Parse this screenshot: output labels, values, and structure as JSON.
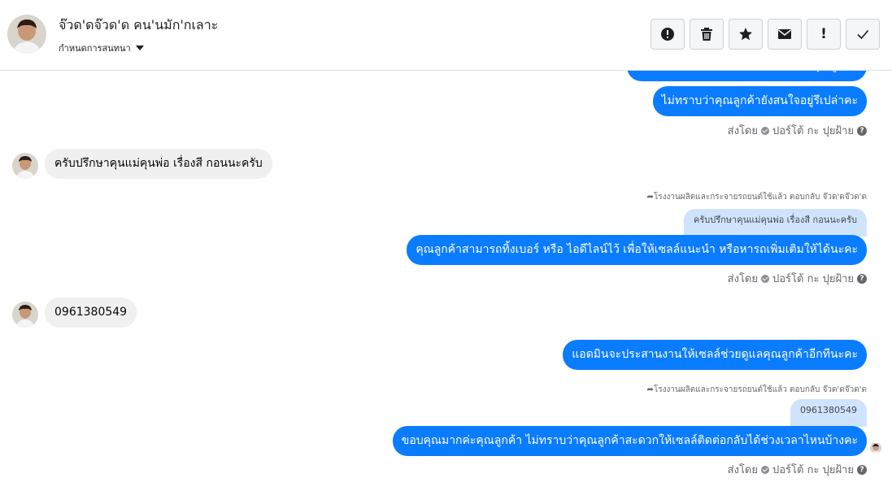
{
  "header": {
    "title": "จ๊วด'ดจ๊วด'ด คน'นมัก'กเลาะ",
    "subtitle": "กำหนดการสนทนา",
    "toolbar": {
      "alert_icon": "alert-circle-icon",
      "delete_icon": "trash-icon",
      "star_icon": "star-icon",
      "mail_icon": "envelope-icon",
      "important_icon": "exclamation-icon",
      "done_icon": "check-icon"
    }
  },
  "messages": {
    "m1_partial": "ทำที่นี่มีรายได้ไม่ได้ค่ะ แต่ได้รับเรื่องคุณลูกค้า",
    "m2": "ไม่ทราบว่าคุณลูกค้ายังสนใจอยู่รึเปล่าคะ",
    "sent_by_label": "ส่งโดย",
    "sent_by_name": "ปอร์โต้ กะ ปุยฝ้าย",
    "help": "?",
    "in1": "ครับปรึกษาคุนแม่คุนพ่อ เรื่องสี กอนนะครับ",
    "reply_meta_1": "โรงงานผลิตและกระจายรถยนต์ใช้แล้ว ตอบกลับ จ๊วด'ดจ๊วด'ด",
    "quote_1": "ครับปรึกษาคุนแม่คุนพ่อ เรื่องสี กอนนะครับ",
    "m3": "คุณลูกค้าสามารถทิ้งเบอร์ หรือ ไอดีไลน์ไว้ เพื่อให้เซลล์แนะนำ หรือหารถเพิ่มเติมให้ได้นะคะ",
    "in2": "0961380549",
    "m4": "แอดมินจะประสานงานให้เซลล์ช่วยดูแลคุณลูกค้าอีกทีนะคะ",
    "reply_meta_2": "โรงงานผลิตและกระจายรถยนต์ใช้แล้ว ตอบกลับ จ๊วด'ดจ๊วด'ด",
    "quote_2": "0961380549",
    "m5": "ขอบคุณมากค่ะคุณลูกค้า ไม่ทราบว่าคุณลูกค้าสะดวกให้เซลล์ติดต่อกลับได้ช่วงเวลาไหนบ้างคะ"
  },
  "colors": {
    "outgoing_bubble": "#0a7cff",
    "incoming_bubble": "#f0f0f0",
    "quote_bubble": "#cfe3fd"
  }
}
